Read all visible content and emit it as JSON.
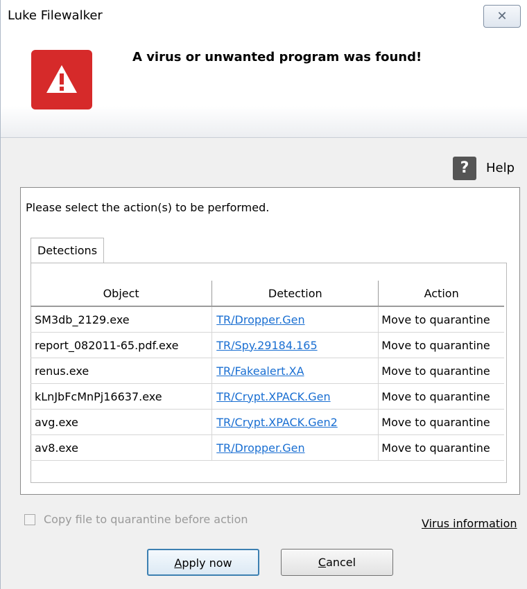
{
  "window": {
    "title": "Luke Filewalker",
    "close_glyph": "✕"
  },
  "banner": {
    "headline": "A virus or unwanted program was found!",
    "warning_icon": "warning-triangle-icon",
    "accent_color": "#d62a2a"
  },
  "help": {
    "icon_glyph": "?",
    "label": "Help"
  },
  "panel": {
    "instruction": "Please select the action(s) to be performed.",
    "tab_label": "Detections",
    "table": {
      "headers": [
        "Object",
        "Detection",
        "Action"
      ],
      "rows": [
        {
          "object": "SM3db_2129.exe",
          "detection": "TR/Dropper.Gen",
          "action": "Move to quarantine"
        },
        {
          "object": "report_082011-65.pdf.exe",
          "detection": "TR/Spy.29184.165",
          "action": "Move to quarantine"
        },
        {
          "object": "renus.exe",
          "detection": "TR/Fakealert.XA",
          "action": "Move to quarantine"
        },
        {
          "object": "kLnJbFcMnPj16637.exe",
          "detection": "TR/Crypt.XPACK.Gen",
          "action": "Move to quarantine"
        },
        {
          "object": "avg.exe",
          "detection": "TR/Crypt.XPACK.Gen2",
          "action": "Move to quarantine"
        },
        {
          "object": "av8.exe",
          "detection": "TR/Dropper.Gen",
          "action": "Move to quarantine"
        }
      ]
    }
  },
  "footer": {
    "checkbox_label": "Copy file to quarantine before action",
    "checkbox_checked": false,
    "virus_info_link": "Virus information",
    "apply_mnemonic": "A",
    "apply_rest": "pply now",
    "cancel_mnemonic": "C",
    "cancel_rest": "ancel"
  }
}
